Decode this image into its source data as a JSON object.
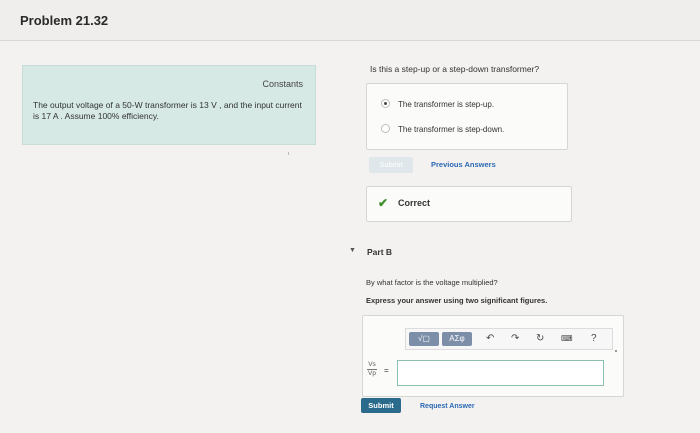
{
  "header": {
    "title": "Problem 21.32"
  },
  "constants": {
    "heading": "Constants",
    "text": "The output voltage of a 50-W transformer is 13 V , and the input current is 17 A . Assume 100% efficiency."
  },
  "part_a": {
    "question": "Is this a step-up or a step-down transformer?",
    "options": [
      {
        "label": "The transformer is step-up.",
        "selected": true
      },
      {
        "label": "The transformer is step-down.",
        "selected": false
      }
    ],
    "submit_label": "Submit",
    "previous_answers_label": "Previous Answers",
    "result_label": "Correct",
    "result_icon": "check-icon",
    "result_color": "#3f8f2f"
  },
  "part_b": {
    "label": "Part B",
    "question": "By what factor is the voltage multiplied?",
    "instruction": "Express your answer using two significant figures.",
    "toolbar": {
      "templates_label": "√▢",
      "greek_label": "ΑΣφ",
      "icons": [
        "undo-icon",
        "redo-icon",
        "reset-icon",
        "keyboard-icon",
        "help-icon"
      ],
      "help_label": "?"
    },
    "fraction": {
      "numerator": "Vs",
      "denominator": "Vp"
    },
    "equals": "=",
    "input_value": "",
    "submit_label": "Submit",
    "request_answer_label": "Request Answer",
    "accent": "#2a6a8a"
  }
}
